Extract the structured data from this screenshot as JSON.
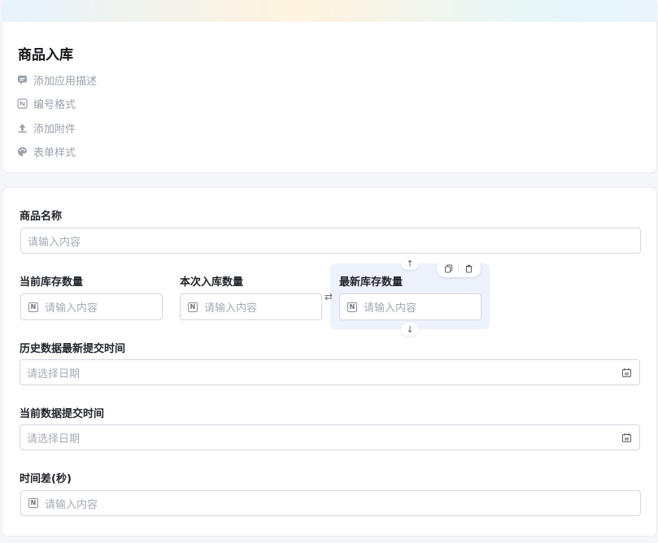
{
  "app": {
    "title": "商品入库",
    "meta": [
      {
        "label": "添加应用描述",
        "icon": "comment-icon"
      },
      {
        "label": "编号格式",
        "icon": "number-format-icon"
      },
      {
        "label": "添加附件",
        "icon": "upload-icon"
      },
      {
        "label": "表单样式",
        "icon": "palette-icon"
      }
    ]
  },
  "form": {
    "product_name": {
      "label": "商品名称",
      "placeholder": "请输入内容"
    },
    "current_stock": {
      "label": "当前库存数量",
      "placeholder": "请输入内容"
    },
    "inbound_qty": {
      "label": "本次入库数量",
      "placeholder": "请输入内容"
    },
    "latest_stock": {
      "label": "最新库存数量",
      "placeholder": "请输入内容"
    },
    "history_submit_time": {
      "label": "历史数据最新提交时间",
      "placeholder": "请选择日期"
    },
    "current_submit_time": {
      "label": "当前数据提交时间",
      "placeholder": "请选择日期"
    },
    "time_diff": {
      "label": "时间差(秒)",
      "placeholder": "请输入内容"
    }
  },
  "icons": {
    "number_field": "N",
    "move_up": "↑",
    "move_down": "↓",
    "swap": "⇄"
  }
}
